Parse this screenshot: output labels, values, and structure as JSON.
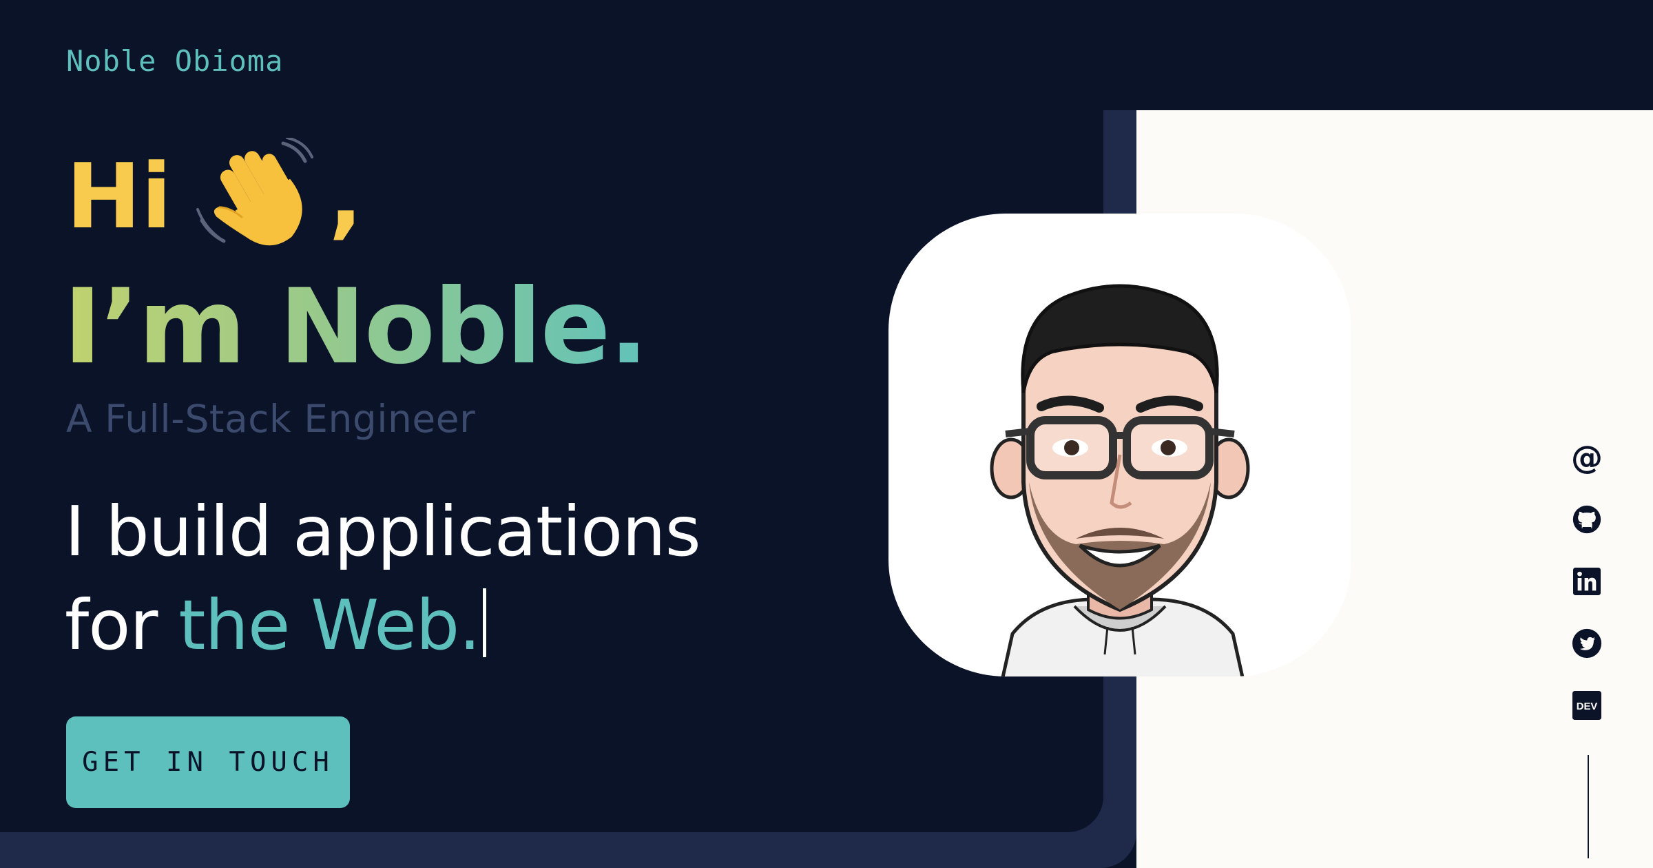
{
  "header": {
    "brand": "Noble Obioma"
  },
  "hero": {
    "greeting": "Hi",
    "greeting_comma": ",",
    "name_line": "I’m Noble.",
    "role": "A Full-Stack Engineer",
    "tagline_line1": "I build applications",
    "tagline_for": "for ",
    "tagline_accent": "the Web.",
    "cta_label": "GET IN TOUCH"
  },
  "social": {
    "at_symbol": "@",
    "icons": [
      "email-icon",
      "github-icon",
      "linkedin-icon",
      "twitter-icon",
      "dev-icon"
    ],
    "dev_label": "DEV"
  },
  "colors": {
    "background": "#0b1329",
    "accent": "#5ec0bd",
    "greeting": "#f8cb4e",
    "role": "#3b4a6d",
    "panel_light": "#fcfbf8"
  }
}
